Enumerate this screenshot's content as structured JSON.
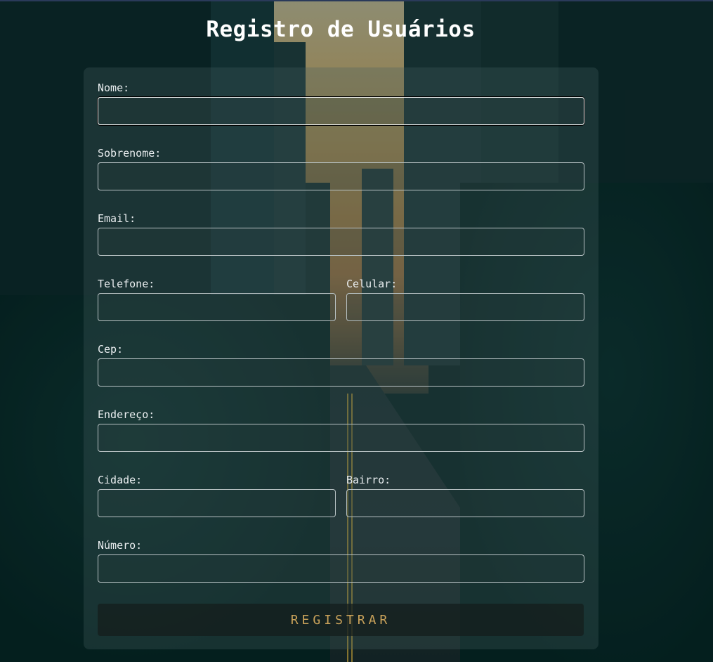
{
  "page": {
    "title": "Registro de Usuários"
  },
  "form": {
    "nome": {
      "label": "Nome:",
      "value": ""
    },
    "sobrenome": {
      "label": "Sobrenome:",
      "value": ""
    },
    "email": {
      "label": "Email:",
      "value": ""
    },
    "telefone": {
      "label": "Telefone:",
      "value": ""
    },
    "celular": {
      "label": "Celular:",
      "value": ""
    },
    "cep": {
      "label": "Cep:",
      "value": ""
    },
    "endereco": {
      "label": "Endereço:",
      "value": ""
    },
    "cidade": {
      "label": "Cidade:",
      "value": ""
    },
    "bairro": {
      "label": "Bairro:",
      "value": ""
    },
    "numero": {
      "label": "Número:",
      "value": ""
    },
    "submit_label": "REGISTRAR",
    "focused_field": "nome"
  },
  "colors": {
    "accent_text": "#c9a25a",
    "input_border": "#b8c2c4"
  }
}
